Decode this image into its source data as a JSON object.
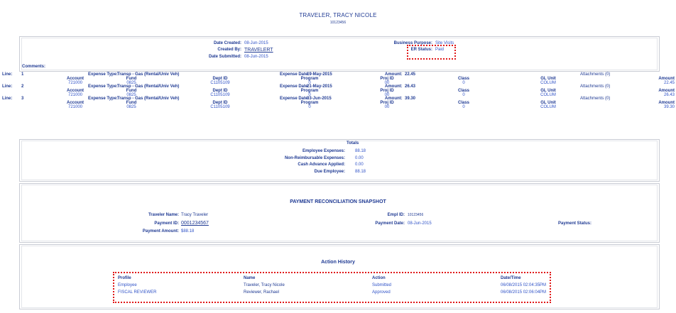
{
  "header": {
    "name": "TRAVELER, TRACY NICOLE",
    "id": "10123456"
  },
  "summary": {
    "date_created_label": "Date Created:",
    "date_created": "08-Jun-2015",
    "created_by_label": "Created By:",
    "created_by": "TRAVELERT",
    "date_submitted_label": "Date Submitted:",
    "date_submitted": "08-Jun-2015",
    "business_purpose_label": "Business Purpose:",
    "business_purpose": "Site Visits",
    "er_status_label": "ER Status:",
    "er_status": "Paid",
    "comments_label": "Comments:"
  },
  "lines_labels": {
    "line": "Line:",
    "expense_type": "Expense Type:",
    "expense_date": "Expense Date:",
    "amount": "Amount:",
    "account": "Account",
    "fund": "Fund",
    "dept_id": "Dept ID",
    "program": "Program",
    "proj_id": "Proj ID",
    "class": "Class",
    "gl_unit": "GL Unit",
    "amount_col": "Amount"
  },
  "lines": [
    {
      "num": "1",
      "expense_type": "Transp - Gas (Rental/Univ Veh)",
      "expense_date": "19-May-2015",
      "amount": "22.45",
      "attachments": "Attachments (0)",
      "account": "721000",
      "fund": "0825",
      "dept_id": "C1105109",
      "program": "0",
      "proj_id": "00",
      "class": "0",
      "gl_unit": "COLUM",
      "amount_col": "22.45"
    },
    {
      "num": "2",
      "expense_type": "Transp - Gas (Rental/Univ Veh)",
      "expense_date": "21-May-2015",
      "amount": "26.43",
      "attachments": "Attachments (0)",
      "account": "721000",
      "fund": "0825",
      "dept_id": "C1105109",
      "program": "0",
      "proj_id": "00",
      "class": "0",
      "gl_unit": "COLUM",
      "amount_col": "26.43"
    },
    {
      "num": "3",
      "expense_type": "Transp - Gas (Rental/Univ Veh)",
      "expense_date": "03-Jun-2015",
      "amount": "39.30",
      "attachments": "Attachments (0)",
      "account": "721000",
      "fund": "0825",
      "dept_id": "C1105109",
      "program": "0",
      "proj_id": "00",
      "class": "0",
      "gl_unit": "COLUM",
      "amount_col": "39.30"
    }
  ],
  "totals": {
    "title": "Totals",
    "rows": [
      {
        "label": "Employee Expenses:",
        "value": "88.18"
      },
      {
        "label": "Non-Reimbursable Expenses:",
        "value": "0.00"
      },
      {
        "label": "Cash Advance Applied:",
        "value": "0.00"
      },
      {
        "label": "Due Employee:",
        "value": "88.18"
      }
    ]
  },
  "payment": {
    "title": "PAYMENT RECONCILIATION SNAPSHOT",
    "traveler_name_label": "Traveler Name:",
    "traveler_name": "Tracy Traveler",
    "payment_id_label": "Payment ID:",
    "payment_id": "0001234567",
    "payment_amount_label": "Payment Amount:",
    "payment_amount": "$88.18",
    "empl_id_label": "Empl ID:",
    "empl_id": "10123456",
    "payment_date_label": "Payment Date:",
    "payment_date": "08-Jun-2015",
    "payment_status_label": "Payment Status:"
  },
  "history": {
    "title": "Action History",
    "headers": {
      "profile": "Profile",
      "name": "Name",
      "action": "Action",
      "datetime": "Date/Time"
    },
    "rows": [
      {
        "profile": "Employee",
        "name": "Traveler, Tracy Nicole",
        "action": "Submitted",
        "datetime": "06/08/2015 02:04:35PM"
      },
      {
        "profile": "FISCAL REVIEWER",
        "name": "Reviewer, Rachael",
        "action": "Approved",
        "datetime": "06/08/2015 02:06:04PM"
      }
    ]
  },
  "colors": {
    "navy": "#1f3a93",
    "value_blue": "#2f52c7",
    "highlight_red": "#e01919",
    "border": "#c9ccd4"
  }
}
